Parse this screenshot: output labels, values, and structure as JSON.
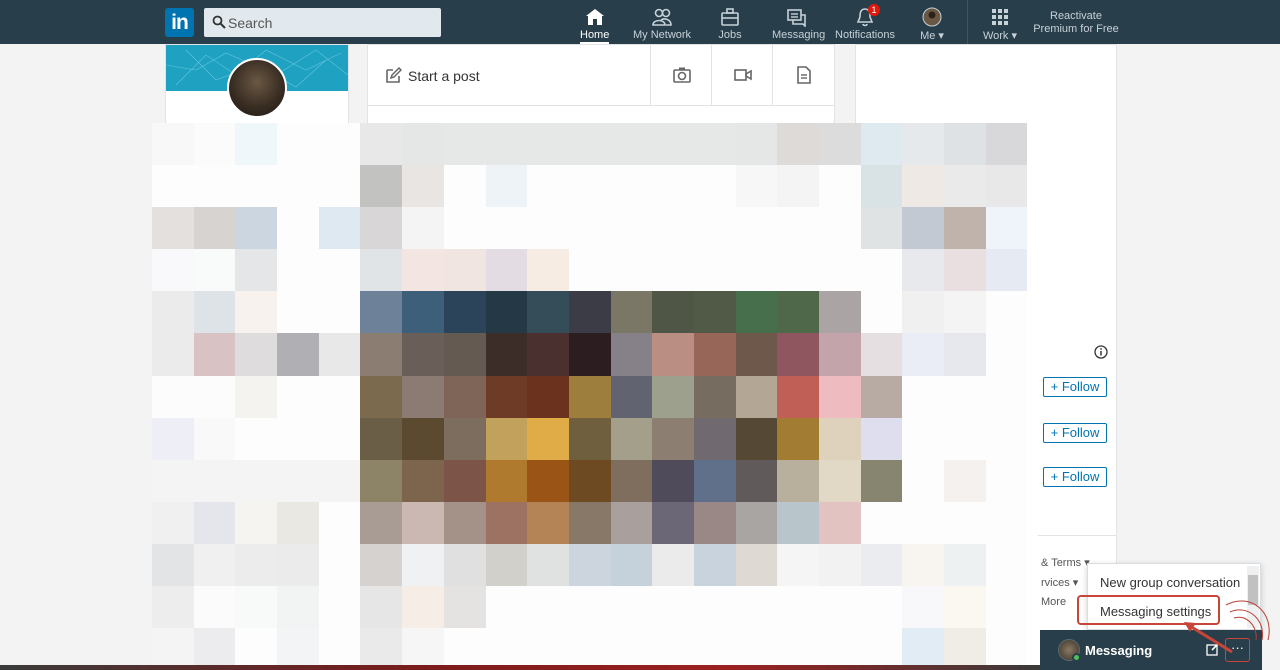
{
  "nav": {
    "logo": "in",
    "search_placeholder": "Search",
    "items": [
      {
        "label": "Home",
        "icon": "home-icon",
        "active": true
      },
      {
        "label": "My Network",
        "icon": "people-icon"
      },
      {
        "label": "Jobs",
        "icon": "briefcase-icon"
      },
      {
        "label": "Messaging",
        "icon": "chat-icon"
      },
      {
        "label": "Notifications",
        "icon": "bell-icon",
        "badge": "1"
      },
      {
        "label": "Me",
        "icon": "avatar-icon"
      },
      {
        "label": "Work",
        "icon": "grid-icon"
      }
    ],
    "reactivate_line1": "Reactivate",
    "reactivate_line2": "Premium for Free"
  },
  "share": {
    "start_post": "Start a post"
  },
  "right": {
    "follow_labels": [
      "+ Follow",
      "+ Follow",
      "+ Follow"
    ],
    "footer_links": [
      "& Terms",
      "rvices",
      "More"
    ]
  },
  "messaging": {
    "title": "Messaging",
    "more_label": "···",
    "menu_items": [
      "New group conversation",
      "Messaging settings"
    ]
  },
  "colors": {
    "nav_bg": "#283e4a",
    "brand_blue": "#0073b1",
    "highlight_red": "#c8453a",
    "badge_red": "#e0190f"
  }
}
